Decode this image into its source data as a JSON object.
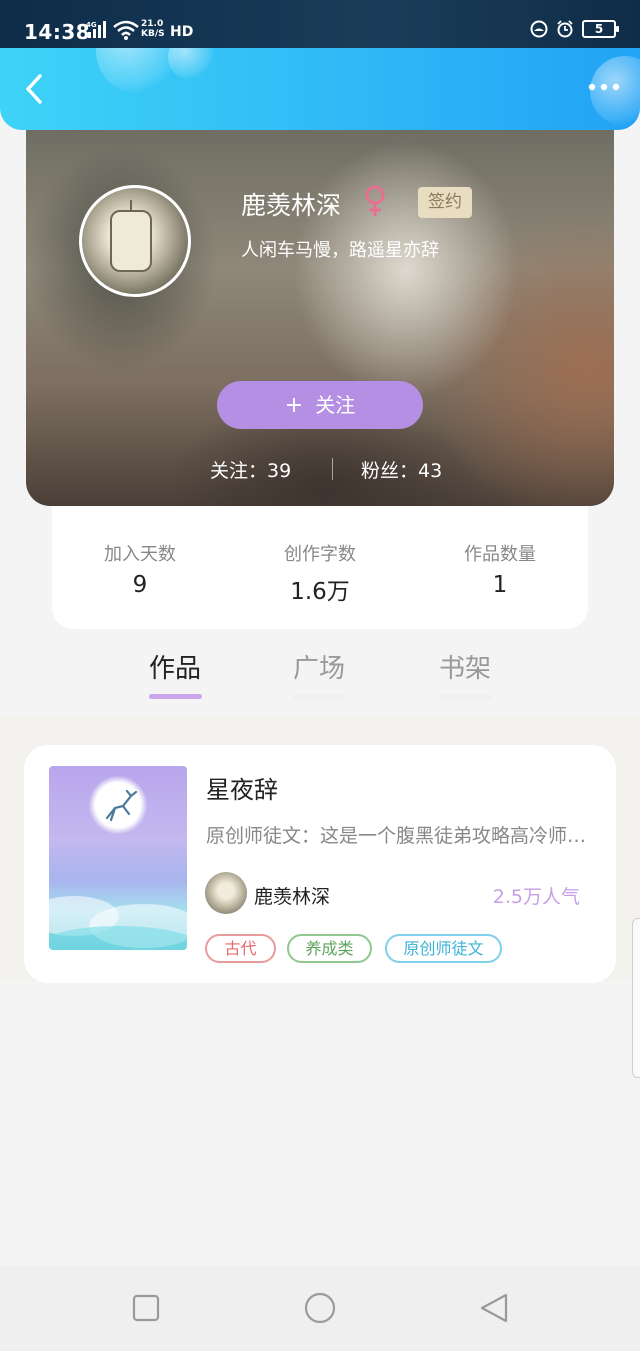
{
  "status_bar": {
    "time": "14:38",
    "network_type": "4G",
    "speed_value": "21.0",
    "speed_unit": "KB/S",
    "hd_label": "HD",
    "battery": "5",
    "icons": [
      "signal-icon",
      "wifi-icon",
      "notification-icon",
      "alarm-icon",
      "battery-icon"
    ]
  },
  "header": {
    "back_icon": "chevron-left-icon",
    "more_icon": "more-dots-icon",
    "accent_gradient": [
      "#3ed3f7",
      "#22a3f5"
    ]
  },
  "profile": {
    "name": "鹿羡林深",
    "gender_icon": "female-icon",
    "badge": "签约",
    "motto": "人闲车马慢，路遥星亦辞",
    "follow_button": "关注",
    "follow_plus": "+",
    "following_label": "关注：39",
    "followers_label": "粉丝：43",
    "accent_purple": "#b58fe3"
  },
  "stats": [
    {
      "label": "加入天数",
      "value": "9"
    },
    {
      "label": "创作字数",
      "value": "1.6万"
    },
    {
      "label": "作品数量",
      "value": "1"
    }
  ],
  "tabs": [
    {
      "label": "作品",
      "active": true
    },
    {
      "label": "广场",
      "active": false
    },
    {
      "label": "书架",
      "active": false
    }
  ],
  "works": [
    {
      "title": "星夜辞",
      "description": "原创师徒文：这是一个腹黑徒弟攻略高冷师尊的故事",
      "author": "鹿羡林深",
      "popularity": "2.5万人气",
      "tags": [
        "古代",
        "养成类",
        "原创师徒文"
      ]
    }
  ],
  "nav_bar": {
    "buttons": [
      "recent-apps-icon",
      "home-icon",
      "back-triangle-icon"
    ]
  }
}
